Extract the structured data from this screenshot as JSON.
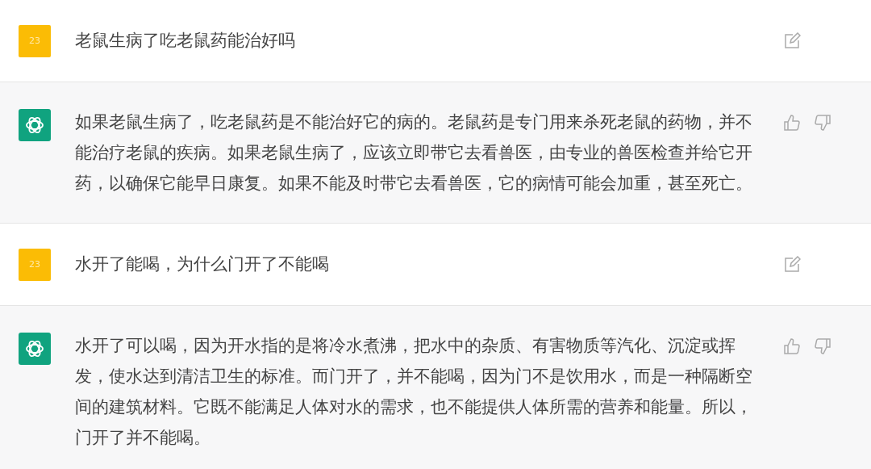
{
  "messages": [
    {
      "kind": "user",
      "avatar": "23",
      "text": "老鼠生病了吃老鼠药能治好吗"
    },
    {
      "kind": "assistant",
      "text": "如果老鼠生病了，吃老鼠药是不能治好它的病的。老鼠药是专门用来杀死老鼠的药物，并不能治疗老鼠的疾病。如果老鼠生病了，应该立即带它去看兽医，由专业的兽医检查并给它开药，以确保它能早日康复。如果不能及时带它去看兽医，它的病情可能会加重，甚至死亡。"
    },
    {
      "kind": "user",
      "avatar": "23",
      "text": "水开了能喝，为什么门开了不能喝"
    },
    {
      "kind": "assistant",
      "text": "水开了可以喝，因为开水指的是将冷水煮沸，把水中的杂质、有害物质等汽化、沉淀或挥发，使水达到清洁卫生的标准。而门开了，并不能喝，因为门不是饮用水，而是一种隔断空间的建筑材料。它既不能满足人体对水的需求，也不能提供人体所需的营养和能量。所以，门开了并不能喝。"
    }
  ]
}
